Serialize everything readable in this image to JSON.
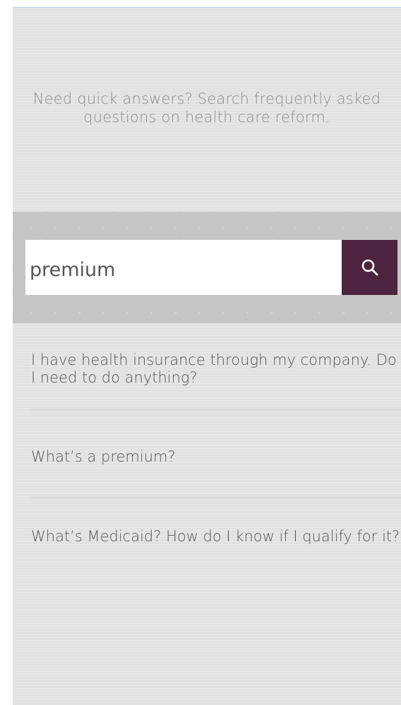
{
  "intro": {
    "text": "Need quick answers? Search frequently asked questions on health care reform."
  },
  "search": {
    "value": "premium",
    "button_icon": "search-icon"
  },
  "results": [
    {
      "text": "I have health insurance through my company. Do I need to do anything?"
    },
    {
      "text": "What’s a premium?"
    },
    {
      "text": "What’s Medicaid? How do I know if I qualify for it?"
    }
  ],
  "colors": {
    "background": "#e2e2e2",
    "search_band": "#c6c6c6",
    "search_button": "#4c2440",
    "text": "#555555",
    "intro_text": "#8d8d8d"
  }
}
